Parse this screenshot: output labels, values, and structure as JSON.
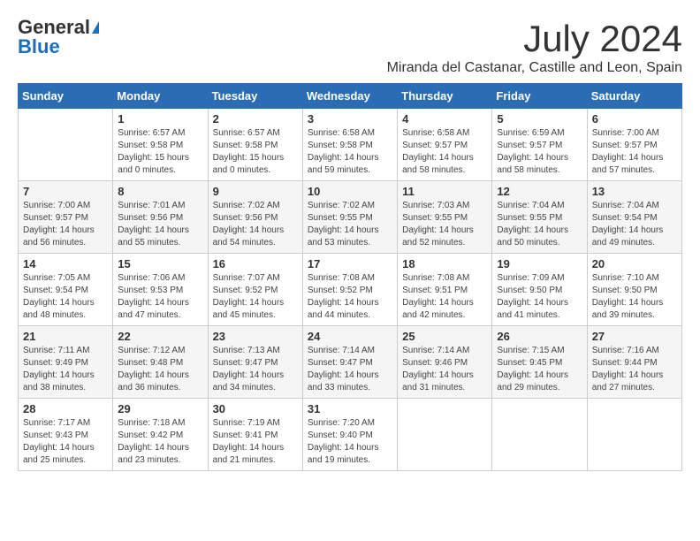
{
  "logo": {
    "general": "General",
    "blue": "Blue"
  },
  "header": {
    "month_year": "July 2024",
    "location": "Miranda del Castanar, Castille and Leon, Spain"
  },
  "weekdays": [
    "Sunday",
    "Monday",
    "Tuesday",
    "Wednesday",
    "Thursday",
    "Friday",
    "Saturday"
  ],
  "weeks": [
    [
      {
        "day": "",
        "info": ""
      },
      {
        "day": "1",
        "info": "Sunrise: 6:57 AM\nSunset: 9:58 PM\nDaylight: 15 hours\nand 0 minutes."
      },
      {
        "day": "2",
        "info": "Sunrise: 6:57 AM\nSunset: 9:58 PM\nDaylight: 15 hours\nand 0 minutes."
      },
      {
        "day": "3",
        "info": "Sunrise: 6:58 AM\nSunset: 9:58 PM\nDaylight: 14 hours\nand 59 minutes."
      },
      {
        "day": "4",
        "info": "Sunrise: 6:58 AM\nSunset: 9:57 PM\nDaylight: 14 hours\nand 58 minutes."
      },
      {
        "day": "5",
        "info": "Sunrise: 6:59 AM\nSunset: 9:57 PM\nDaylight: 14 hours\nand 58 minutes."
      },
      {
        "day": "6",
        "info": "Sunrise: 7:00 AM\nSunset: 9:57 PM\nDaylight: 14 hours\nand 57 minutes."
      }
    ],
    [
      {
        "day": "7",
        "info": "Sunrise: 7:00 AM\nSunset: 9:57 PM\nDaylight: 14 hours\nand 56 minutes."
      },
      {
        "day": "8",
        "info": "Sunrise: 7:01 AM\nSunset: 9:56 PM\nDaylight: 14 hours\nand 55 minutes."
      },
      {
        "day": "9",
        "info": "Sunrise: 7:02 AM\nSunset: 9:56 PM\nDaylight: 14 hours\nand 54 minutes."
      },
      {
        "day": "10",
        "info": "Sunrise: 7:02 AM\nSunset: 9:55 PM\nDaylight: 14 hours\nand 53 minutes."
      },
      {
        "day": "11",
        "info": "Sunrise: 7:03 AM\nSunset: 9:55 PM\nDaylight: 14 hours\nand 52 minutes."
      },
      {
        "day": "12",
        "info": "Sunrise: 7:04 AM\nSunset: 9:55 PM\nDaylight: 14 hours\nand 50 minutes."
      },
      {
        "day": "13",
        "info": "Sunrise: 7:04 AM\nSunset: 9:54 PM\nDaylight: 14 hours\nand 49 minutes."
      }
    ],
    [
      {
        "day": "14",
        "info": "Sunrise: 7:05 AM\nSunset: 9:54 PM\nDaylight: 14 hours\nand 48 minutes."
      },
      {
        "day": "15",
        "info": "Sunrise: 7:06 AM\nSunset: 9:53 PM\nDaylight: 14 hours\nand 47 minutes."
      },
      {
        "day": "16",
        "info": "Sunrise: 7:07 AM\nSunset: 9:52 PM\nDaylight: 14 hours\nand 45 minutes."
      },
      {
        "day": "17",
        "info": "Sunrise: 7:08 AM\nSunset: 9:52 PM\nDaylight: 14 hours\nand 44 minutes."
      },
      {
        "day": "18",
        "info": "Sunrise: 7:08 AM\nSunset: 9:51 PM\nDaylight: 14 hours\nand 42 minutes."
      },
      {
        "day": "19",
        "info": "Sunrise: 7:09 AM\nSunset: 9:50 PM\nDaylight: 14 hours\nand 41 minutes."
      },
      {
        "day": "20",
        "info": "Sunrise: 7:10 AM\nSunset: 9:50 PM\nDaylight: 14 hours\nand 39 minutes."
      }
    ],
    [
      {
        "day": "21",
        "info": "Sunrise: 7:11 AM\nSunset: 9:49 PM\nDaylight: 14 hours\nand 38 minutes."
      },
      {
        "day": "22",
        "info": "Sunrise: 7:12 AM\nSunset: 9:48 PM\nDaylight: 14 hours\nand 36 minutes."
      },
      {
        "day": "23",
        "info": "Sunrise: 7:13 AM\nSunset: 9:47 PM\nDaylight: 14 hours\nand 34 minutes."
      },
      {
        "day": "24",
        "info": "Sunrise: 7:14 AM\nSunset: 9:47 PM\nDaylight: 14 hours\nand 33 minutes."
      },
      {
        "day": "25",
        "info": "Sunrise: 7:14 AM\nSunset: 9:46 PM\nDaylight: 14 hours\nand 31 minutes."
      },
      {
        "day": "26",
        "info": "Sunrise: 7:15 AM\nSunset: 9:45 PM\nDaylight: 14 hours\nand 29 minutes."
      },
      {
        "day": "27",
        "info": "Sunrise: 7:16 AM\nSunset: 9:44 PM\nDaylight: 14 hours\nand 27 minutes."
      }
    ],
    [
      {
        "day": "28",
        "info": "Sunrise: 7:17 AM\nSunset: 9:43 PM\nDaylight: 14 hours\nand 25 minutes."
      },
      {
        "day": "29",
        "info": "Sunrise: 7:18 AM\nSunset: 9:42 PM\nDaylight: 14 hours\nand 23 minutes."
      },
      {
        "day": "30",
        "info": "Sunrise: 7:19 AM\nSunset: 9:41 PM\nDaylight: 14 hours\nand 21 minutes."
      },
      {
        "day": "31",
        "info": "Sunrise: 7:20 AM\nSunset: 9:40 PM\nDaylight: 14 hours\nand 19 minutes."
      },
      {
        "day": "",
        "info": ""
      },
      {
        "day": "",
        "info": ""
      },
      {
        "day": "",
        "info": ""
      }
    ]
  ]
}
